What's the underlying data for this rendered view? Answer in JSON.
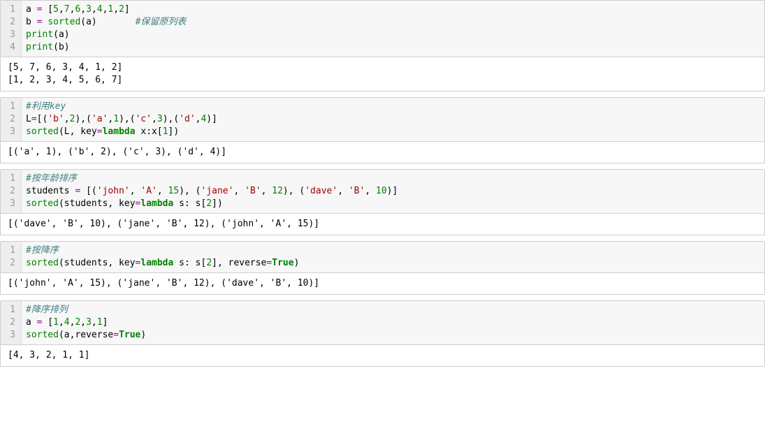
{
  "cells": [
    {
      "code": [
        [
          {
            "t": "a ",
            "c": "c-var"
          },
          {
            "t": "=",
            "c": "c-op"
          },
          {
            "t": " [",
            "c": "c-punc"
          },
          {
            "t": "5",
            "c": "c-num"
          },
          {
            "t": ",",
            "c": "c-punc"
          },
          {
            "t": "7",
            "c": "c-num"
          },
          {
            "t": ",",
            "c": "c-punc"
          },
          {
            "t": "6",
            "c": "c-num"
          },
          {
            "t": ",",
            "c": "c-punc"
          },
          {
            "t": "3",
            "c": "c-num"
          },
          {
            "t": ",",
            "c": "c-punc"
          },
          {
            "t": "4",
            "c": "c-num"
          },
          {
            "t": ",",
            "c": "c-punc"
          },
          {
            "t": "1",
            "c": "c-num"
          },
          {
            "t": ",",
            "c": "c-punc"
          },
          {
            "t": "2",
            "c": "c-num"
          },
          {
            "t": "]",
            "c": "c-punc"
          }
        ],
        [
          {
            "t": "b ",
            "c": "c-var"
          },
          {
            "t": "=",
            "c": "c-op"
          },
          {
            "t": " ",
            "c": "c-var"
          },
          {
            "t": "sorted",
            "c": "c-func"
          },
          {
            "t": "(a)       ",
            "c": "c-punc"
          },
          {
            "t": "#保留原列表",
            "c": "c-cmt"
          }
        ],
        [
          {
            "t": "print",
            "c": "c-func"
          },
          {
            "t": "(a)",
            "c": "c-punc"
          }
        ],
        [
          {
            "t": "print",
            "c": "c-func"
          },
          {
            "t": "(b)",
            "c": "c-punc"
          }
        ]
      ],
      "output": "[5, 7, 6, 3, 4, 1, 2]\n[1, 2, 3, 4, 5, 6, 7]"
    },
    {
      "code": [
        [
          {
            "t": "#利用key",
            "c": "c-cmt"
          }
        ],
        [
          {
            "t": "L",
            "c": "c-var"
          },
          {
            "t": "=",
            "c": "c-op"
          },
          {
            "t": "[(",
            "c": "c-punc"
          },
          {
            "t": "'b'",
            "c": "c-str"
          },
          {
            "t": ",",
            "c": "c-punc"
          },
          {
            "t": "2",
            "c": "c-num"
          },
          {
            "t": "),(",
            "c": "c-punc"
          },
          {
            "t": "'a'",
            "c": "c-str"
          },
          {
            "t": ",",
            "c": "c-punc"
          },
          {
            "t": "1",
            "c": "c-num"
          },
          {
            "t": "),(",
            "c": "c-punc"
          },
          {
            "t": "'c'",
            "c": "c-str"
          },
          {
            "t": ",",
            "c": "c-punc"
          },
          {
            "t": "3",
            "c": "c-num"
          },
          {
            "t": "),(",
            "c": "c-punc"
          },
          {
            "t": "'d'",
            "c": "c-str"
          },
          {
            "t": ",",
            "c": "c-punc"
          },
          {
            "t": "4",
            "c": "c-num"
          },
          {
            "t": ")]",
            "c": "c-punc"
          }
        ],
        [
          {
            "t": "sorted",
            "c": "c-func"
          },
          {
            "t": "(L, key",
            "c": "c-punc"
          },
          {
            "t": "=",
            "c": "c-op"
          },
          {
            "t": "lambda",
            "c": "c-kw"
          },
          {
            "t": " x:x[",
            "c": "c-punc"
          },
          {
            "t": "1",
            "c": "c-num"
          },
          {
            "t": "])",
            "c": "c-punc"
          }
        ]
      ],
      "output": "[('a', 1), ('b', 2), ('c', 3), ('d', 4)]"
    },
    {
      "code": [
        [
          {
            "t": "#按年龄排序",
            "c": "c-cmt"
          }
        ],
        [
          {
            "t": "students ",
            "c": "c-var"
          },
          {
            "t": "=",
            "c": "c-op"
          },
          {
            "t": " [(",
            "c": "c-punc"
          },
          {
            "t": "'john'",
            "c": "c-str"
          },
          {
            "t": ", ",
            "c": "c-punc"
          },
          {
            "t": "'A'",
            "c": "c-str"
          },
          {
            "t": ", ",
            "c": "c-punc"
          },
          {
            "t": "15",
            "c": "c-num"
          },
          {
            "t": "), (",
            "c": "c-punc"
          },
          {
            "t": "'jane'",
            "c": "c-str"
          },
          {
            "t": ", ",
            "c": "c-punc"
          },
          {
            "t": "'B'",
            "c": "c-str"
          },
          {
            "t": ", ",
            "c": "c-punc"
          },
          {
            "t": "12",
            "c": "c-num"
          },
          {
            "t": "), (",
            "c": "c-punc"
          },
          {
            "t": "'dave'",
            "c": "c-str"
          },
          {
            "t": ", ",
            "c": "c-punc"
          },
          {
            "t": "'B'",
            "c": "c-str"
          },
          {
            "t": ", ",
            "c": "c-punc"
          },
          {
            "t": "10",
            "c": "c-num"
          },
          {
            "t": ")]",
            "c": "c-punc"
          }
        ],
        [
          {
            "t": "sorted",
            "c": "c-func"
          },
          {
            "t": "(students, key",
            "c": "c-punc"
          },
          {
            "t": "=",
            "c": "c-op"
          },
          {
            "t": "lambda",
            "c": "c-kw"
          },
          {
            "t": " s: s[",
            "c": "c-punc"
          },
          {
            "t": "2",
            "c": "c-num"
          },
          {
            "t": "])",
            "c": "c-punc"
          }
        ]
      ],
      "output": "[('dave', 'B', 10), ('jane', 'B', 12), ('john', 'A', 15)]"
    },
    {
      "code": [
        [
          {
            "t": "#按降序",
            "c": "c-cmt"
          }
        ],
        [
          {
            "t": "sorted",
            "c": "c-func"
          },
          {
            "t": "(students, key",
            "c": "c-punc"
          },
          {
            "t": "=",
            "c": "c-op"
          },
          {
            "t": "lambda",
            "c": "c-kw"
          },
          {
            "t": " s: s[",
            "c": "c-punc"
          },
          {
            "t": "2",
            "c": "c-num"
          },
          {
            "t": "], reverse",
            "c": "c-punc"
          },
          {
            "t": "=",
            "c": "c-op"
          },
          {
            "t": "True",
            "c": "c-bool"
          },
          {
            "t": ")",
            "c": "c-punc"
          }
        ]
      ],
      "output": "[('john', 'A', 15), ('jane', 'B', 12), ('dave', 'B', 10)]"
    },
    {
      "code": [
        [
          {
            "t": "#降序排列",
            "c": "c-cmt"
          }
        ],
        [
          {
            "t": "a ",
            "c": "c-var"
          },
          {
            "t": "=",
            "c": "c-op"
          },
          {
            "t": " [",
            "c": "c-punc"
          },
          {
            "t": "1",
            "c": "c-num"
          },
          {
            "t": ",",
            "c": "c-punc"
          },
          {
            "t": "4",
            "c": "c-num"
          },
          {
            "t": ",",
            "c": "c-punc"
          },
          {
            "t": "2",
            "c": "c-num"
          },
          {
            "t": ",",
            "c": "c-punc"
          },
          {
            "t": "3",
            "c": "c-num"
          },
          {
            "t": ",",
            "c": "c-punc"
          },
          {
            "t": "1",
            "c": "c-num"
          },
          {
            "t": "]",
            "c": "c-punc"
          }
        ],
        [
          {
            "t": "sorted",
            "c": "c-func"
          },
          {
            "t": "(a,reverse",
            "c": "c-punc"
          },
          {
            "t": "=",
            "c": "c-op"
          },
          {
            "t": "True",
            "c": "c-bool"
          },
          {
            "t": ")",
            "c": "c-punc"
          }
        ]
      ],
      "output": "[4, 3, 2, 1, 1]"
    }
  ]
}
